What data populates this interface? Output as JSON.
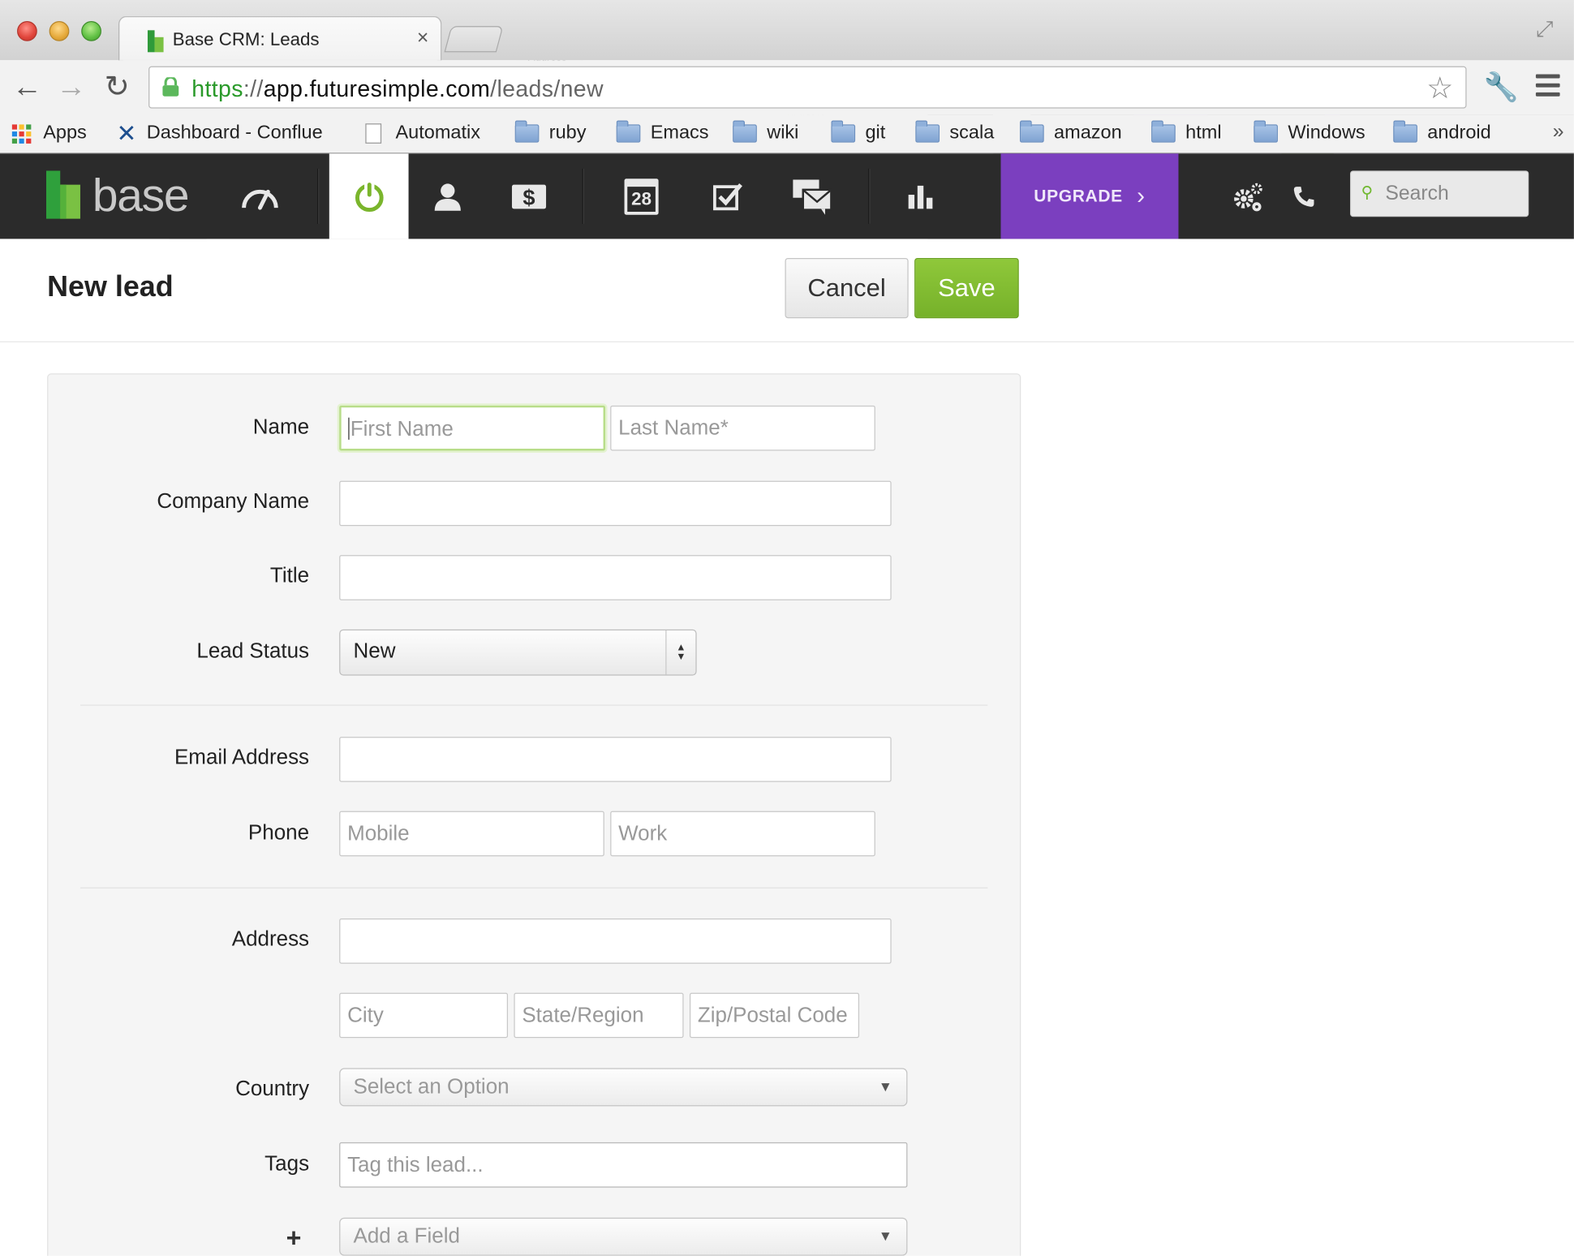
{
  "browser": {
    "tab_title": "Base CRM: Leads",
    "tab_close": "×",
    "url_scheme": "https",
    "url_sep": "://",
    "url_host": "app.futuresimple.com",
    "url_path": "/leads/new",
    "bookmarks": [
      "Apps",
      "Dashboard - Conflue",
      "Automatix",
      "ruby",
      "Emacs",
      "wiki",
      "git",
      "scala",
      "amazon",
      "html",
      "Windows",
      "android"
    ],
    "more": "»"
  },
  "appnav": {
    "logo_text": "base",
    "calendar_day": "28",
    "upgrade_label": "UPGRADE",
    "upgrade_chevron": "›",
    "search_placeholder": "Search",
    "brand_green": "#7ab52c",
    "upgrade_color": "#7b3fbf"
  },
  "page": {
    "title": "New lead",
    "cancel_label": "Cancel",
    "save_label": "Save"
  },
  "form": {
    "name_label": "Name",
    "first_name_ph": "First Name",
    "last_name_ph": "Last Name*",
    "company_label": "Company Name",
    "title_label": "Title",
    "status_label": "Lead Status",
    "status_value": "New",
    "email_label": "Email Address",
    "phone_label": "Phone",
    "mobile_ph": "Mobile",
    "work_ph": "Work",
    "address_label": "Address",
    "city_ph": "City",
    "state_ph": "State/Region",
    "zip_ph": "Zip/Postal Code",
    "country_label": "Country",
    "country_ph": "Select an Option",
    "tags_label": "Tags",
    "tags_ph": "Tag this lead...",
    "add_field_ph": "Add a Field"
  }
}
